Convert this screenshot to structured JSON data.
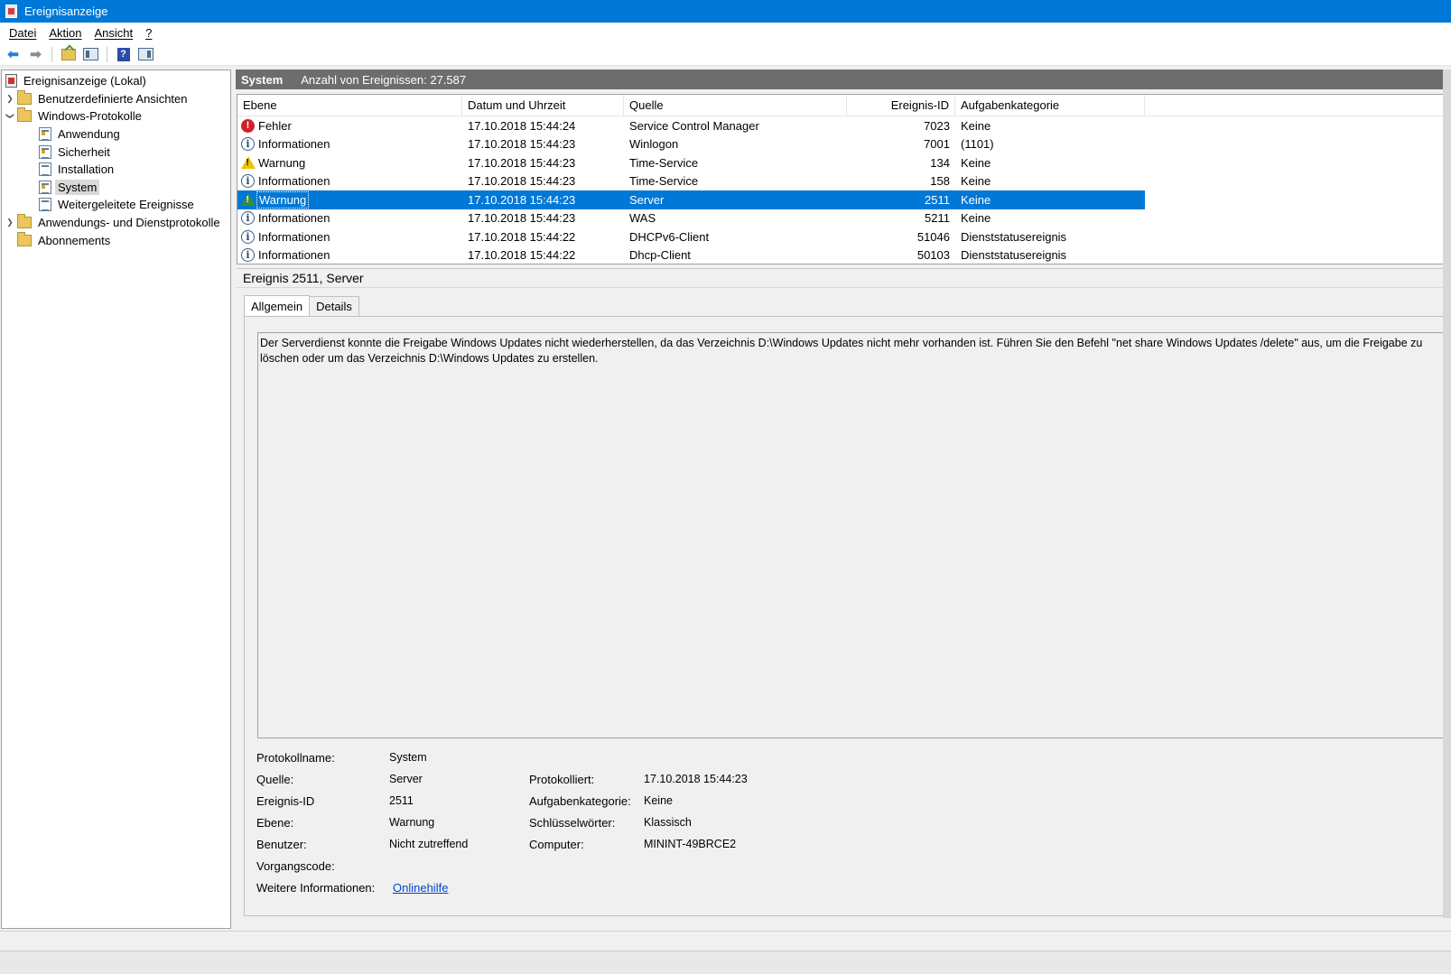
{
  "window": {
    "title": "Ereignisanzeige"
  },
  "menu": {
    "items": [
      "Datei",
      "Aktion",
      "Ansicht",
      "?"
    ]
  },
  "toolbar": {
    "buttons": [
      "back-arrow-icon",
      "forward-arrow-icon",
      "up-folder-icon",
      "show-hide-tree-icon",
      "help-icon",
      "show-hide-action-pane-icon"
    ]
  },
  "tree": {
    "root": "Ereignisanzeige (Lokal)",
    "custom_views": "Benutzerdefinierte Ansichten",
    "windows_logs": "Windows-Protokolle",
    "logs": [
      "Anwendung",
      "Sicherheit",
      "Installation",
      "System",
      "Weitergeleitete Ereignisse"
    ],
    "app_service_logs": "Anwendungs- und Dienstprotokolle",
    "subscriptions": "Abonnements"
  },
  "list": {
    "log_name": "System",
    "count_text": "Anzahl von Ereignissen: 27.587",
    "columns": [
      "Ebene",
      "Datum und Uhrzeit",
      "Quelle",
      "Ereignis-ID",
      "Aufgabenkategorie"
    ],
    "rows": [
      {
        "level": "Fehler",
        "icon": "error-icon",
        "date": "17.10.2018 15:44:24",
        "source": "Service Control Manager",
        "id": "7023",
        "category": "Keine"
      },
      {
        "level": "Informationen",
        "icon": "info-icon",
        "date": "17.10.2018 15:44:23",
        "source": "Winlogon",
        "id": "7001",
        "category": "(1101)"
      },
      {
        "level": "Warnung",
        "icon": "warning-icon",
        "date": "17.10.2018 15:44:23",
        "source": "Time-Service",
        "id": "134",
        "category": "Keine"
      },
      {
        "level": "Informationen",
        "icon": "info-icon",
        "date": "17.10.2018 15:44:23",
        "source": "Time-Service",
        "id": "158",
        "category": "Keine"
      },
      {
        "level": "Warnung",
        "icon": "warning-icon",
        "date": "17.10.2018 15:44:23",
        "source": "Server",
        "id": "2511",
        "category": "Keine"
      },
      {
        "level": "Informationen",
        "icon": "info-icon",
        "date": "17.10.2018 15:44:23",
        "source": "WAS",
        "id": "5211",
        "category": "Keine"
      },
      {
        "level": "Informationen",
        "icon": "info-icon",
        "date": "17.10.2018 15:44:22",
        "source": "DHCPv6-Client",
        "id": "51046",
        "category": "Dienststatusereignis"
      },
      {
        "level": "Informationen",
        "icon": "info-icon",
        "date": "17.10.2018 15:44:22",
        "source": "Dhcp-Client",
        "id": "50103",
        "category": "Dienststatusereignis"
      }
    ],
    "selected_index": 4
  },
  "detail": {
    "title": "Ereignis 2511, Server",
    "tabs": [
      "Allgemein",
      "Details"
    ],
    "active_tab": "Allgemein",
    "message": "Der Serverdienst konnte die Freigabe Windows Updates nicht wiederherstellen, da das Verzeichnis D:\\Windows Updates nicht mehr vorhanden ist. Führen Sie den Befehl \"net share Windows Updates /delete\" aus, um die Freigabe zu löschen oder um das Verzeichnis D:\\Windows Updates zu erstellen.",
    "labels": {
      "log_name": "Protokollname:",
      "source": "Quelle:",
      "event_id": "Ereignis-ID",
      "level": "Ebene:",
      "user": "Benutzer:",
      "opcode": "Vorgangscode:",
      "more_info": "Weitere Informationen:",
      "logged": "Protokolliert:",
      "task_category": "Aufgabenkategorie:",
      "keywords": "Schlüsselwörter:",
      "computer": "Computer:"
    },
    "values": {
      "log_name": "System",
      "source": "Server",
      "event_id": "2511",
      "level": "Warnung",
      "user": "Nicht zutreffend",
      "opcode": "",
      "more_info": "Onlinehilfe",
      "logged": "17.10.2018 15:44:23",
      "task_category": "Keine",
      "keywords": "Klassisch",
      "computer": "MININT-49BRCE2"
    }
  }
}
